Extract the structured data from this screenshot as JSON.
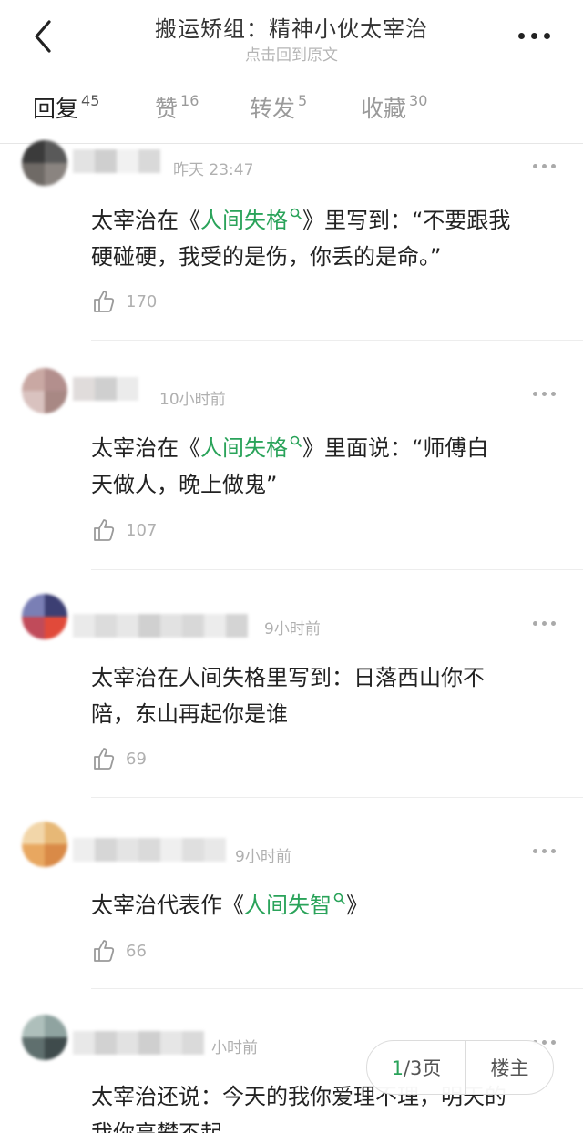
{
  "header": {
    "title": "搬运矫组：精神小伙太宰治",
    "subtitle": "点击回到原文"
  },
  "tabs": [
    {
      "label": "回复",
      "count": "45"
    },
    {
      "label": "赞",
      "count": "16"
    },
    {
      "label": "转发",
      "count": "5"
    },
    {
      "label": "收藏",
      "count": "30"
    }
  ],
  "comments": [
    {
      "time": "昨天 23:47",
      "line1_pre": "太宰治在《",
      "link": "人间失格",
      "line1_post": "》里写到：“不要跟我",
      "line2": "硬碰硬，我受的是伤，你丢的是命。”",
      "likes": "170"
    },
    {
      "time": "10小时前",
      "line1_pre": "太宰治在《",
      "link": "人间失格",
      "line1_post": "》里面说：“师傅白",
      "line2": "天做人，晚上做鬼”",
      "likes": "107"
    },
    {
      "time": "9小时前",
      "line1": "太宰治在人间失格里写到：日落西山你不",
      "line2": "陪，东山再起你是谁",
      "likes": "69"
    },
    {
      "time": "9小时前",
      "line1_pre": "太宰治代表作《",
      "link": "人间失智",
      "line1_post": "》",
      "likes": "66"
    },
    {
      "time": "小时前",
      "line1": "太宰治还说：今天的我你爱理不理，明天的",
      "line2": "我你高攀不起"
    }
  ],
  "pager": {
    "current": "1",
    "total_label": "/3页",
    "host_label": "楼主"
  },
  "colors": {
    "link_green": "#2aa35a",
    "muted": "#b0b0b0"
  },
  "icons": [
    "back-arrow-icon",
    "more-dots-icon",
    "search-mini-icon",
    "thumbs-up-icon"
  ]
}
